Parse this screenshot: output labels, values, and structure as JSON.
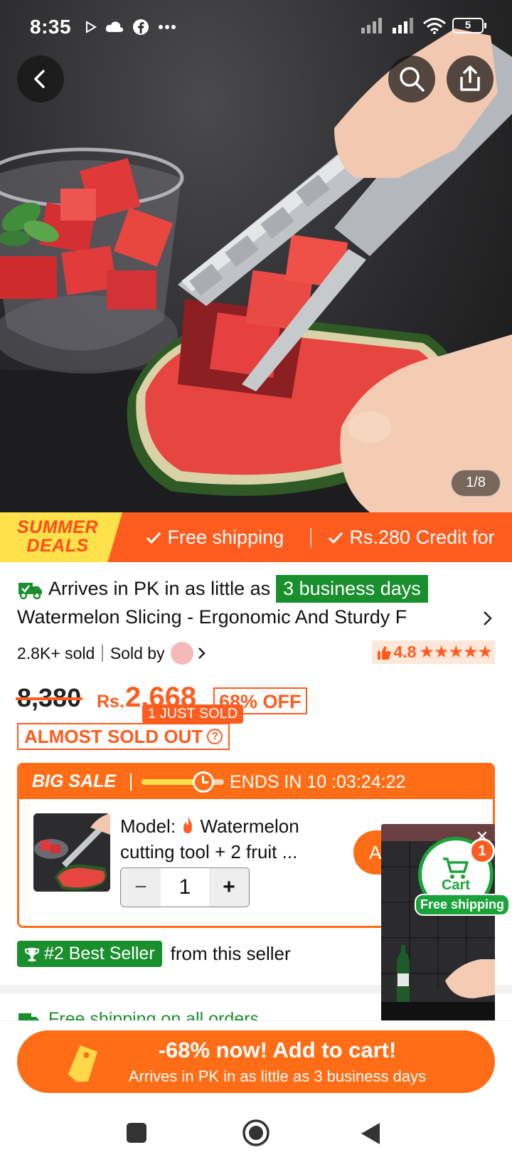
{
  "status_bar": {
    "time": "8:35",
    "battery": "5"
  },
  "hero": {
    "image_counter": "1/8"
  },
  "promo": {
    "summer_line1": "SUMMER",
    "summer_line2": "DEALS",
    "item1": "Free shipping",
    "item2": "Rs.280 Credit for"
  },
  "delivery": {
    "prefix": "Arrives in PK in as little as",
    "days": "3 business days"
  },
  "product": {
    "title": "Watermelon Slicing - Ergonomic And Sturdy F",
    "sold": "2.8K+ sold",
    "sold_by": "Sold by",
    "rating": "4.8",
    "stars": "★★★★★",
    "old_price": "8,380",
    "currency": "Rs.",
    "price": "2,668",
    "discount": "68% OFF",
    "just_sold": "1 JUST SOLD",
    "almost_sold_out": "ALMOST SOLD OUT"
  },
  "sale": {
    "label": "BIG SALE",
    "ends_label": "ENDS IN",
    "countdown": "10 :03:24:22",
    "progress": 0.75,
    "model_label": "Model:",
    "model_value": "Watermelon cutting tool + 2 fruit ...",
    "quantity": "1",
    "minus": "−",
    "plus": "+",
    "add_button": "A"
  },
  "best_seller": {
    "badge": "#2 Best Seller",
    "suffix": "from this seller"
  },
  "free_shipping_all": "Free shipping on all orders",
  "floating_cart": {
    "label": "Cart",
    "count": "1",
    "free": "Free shipping"
  },
  "add_to_cart": {
    "main": "-68% now! Add to cart!",
    "sub": "Arrives in PK in as little as 3 business days"
  },
  "colors": {
    "accent": "#ff6d16",
    "promo": "#ff5c1f",
    "green": "#1a8f2e",
    "summer": "#ffe14b"
  }
}
